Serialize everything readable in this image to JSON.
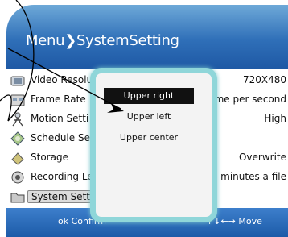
{
  "header": {
    "title": "Menu❯SystemSetting"
  },
  "menu_items": [
    {
      "label": "Video Resolu",
      "value": "720X480",
      "icon": "video-icon"
    },
    {
      "label": "Frame Rate",
      "value": "rame per second",
      "icon": "frames-icon"
    },
    {
      "label": "Motion Setti",
      "value": "High",
      "icon": "motion-icon"
    },
    {
      "label": "Schedule Se",
      "value": "",
      "icon": "schedule-icon"
    },
    {
      "label": "Storage",
      "value": "Overwrite",
      "icon": "storage-icon"
    },
    {
      "label": "Recording Le",
      "value": "30 minutes a file",
      "icon": "recording-icon"
    },
    {
      "label": "System Sett",
      "value": "",
      "icon": "folder-icon",
      "selected": true
    }
  ],
  "popup": {
    "options": [
      {
        "label": "Upper right",
        "selected": true
      },
      {
        "label": "Upper left",
        "selected": false
      },
      {
        "label": "Upper center",
        "selected": false
      }
    ]
  },
  "footer": {
    "confirm": "ok Confirm",
    "move": "↑↓←→ Move"
  },
  "colors": {
    "header_top": "#6ea9d8",
    "header_bottom": "#1e58a4",
    "popup_border": "#8fd6d9",
    "selected_option_bg": "#111111"
  }
}
